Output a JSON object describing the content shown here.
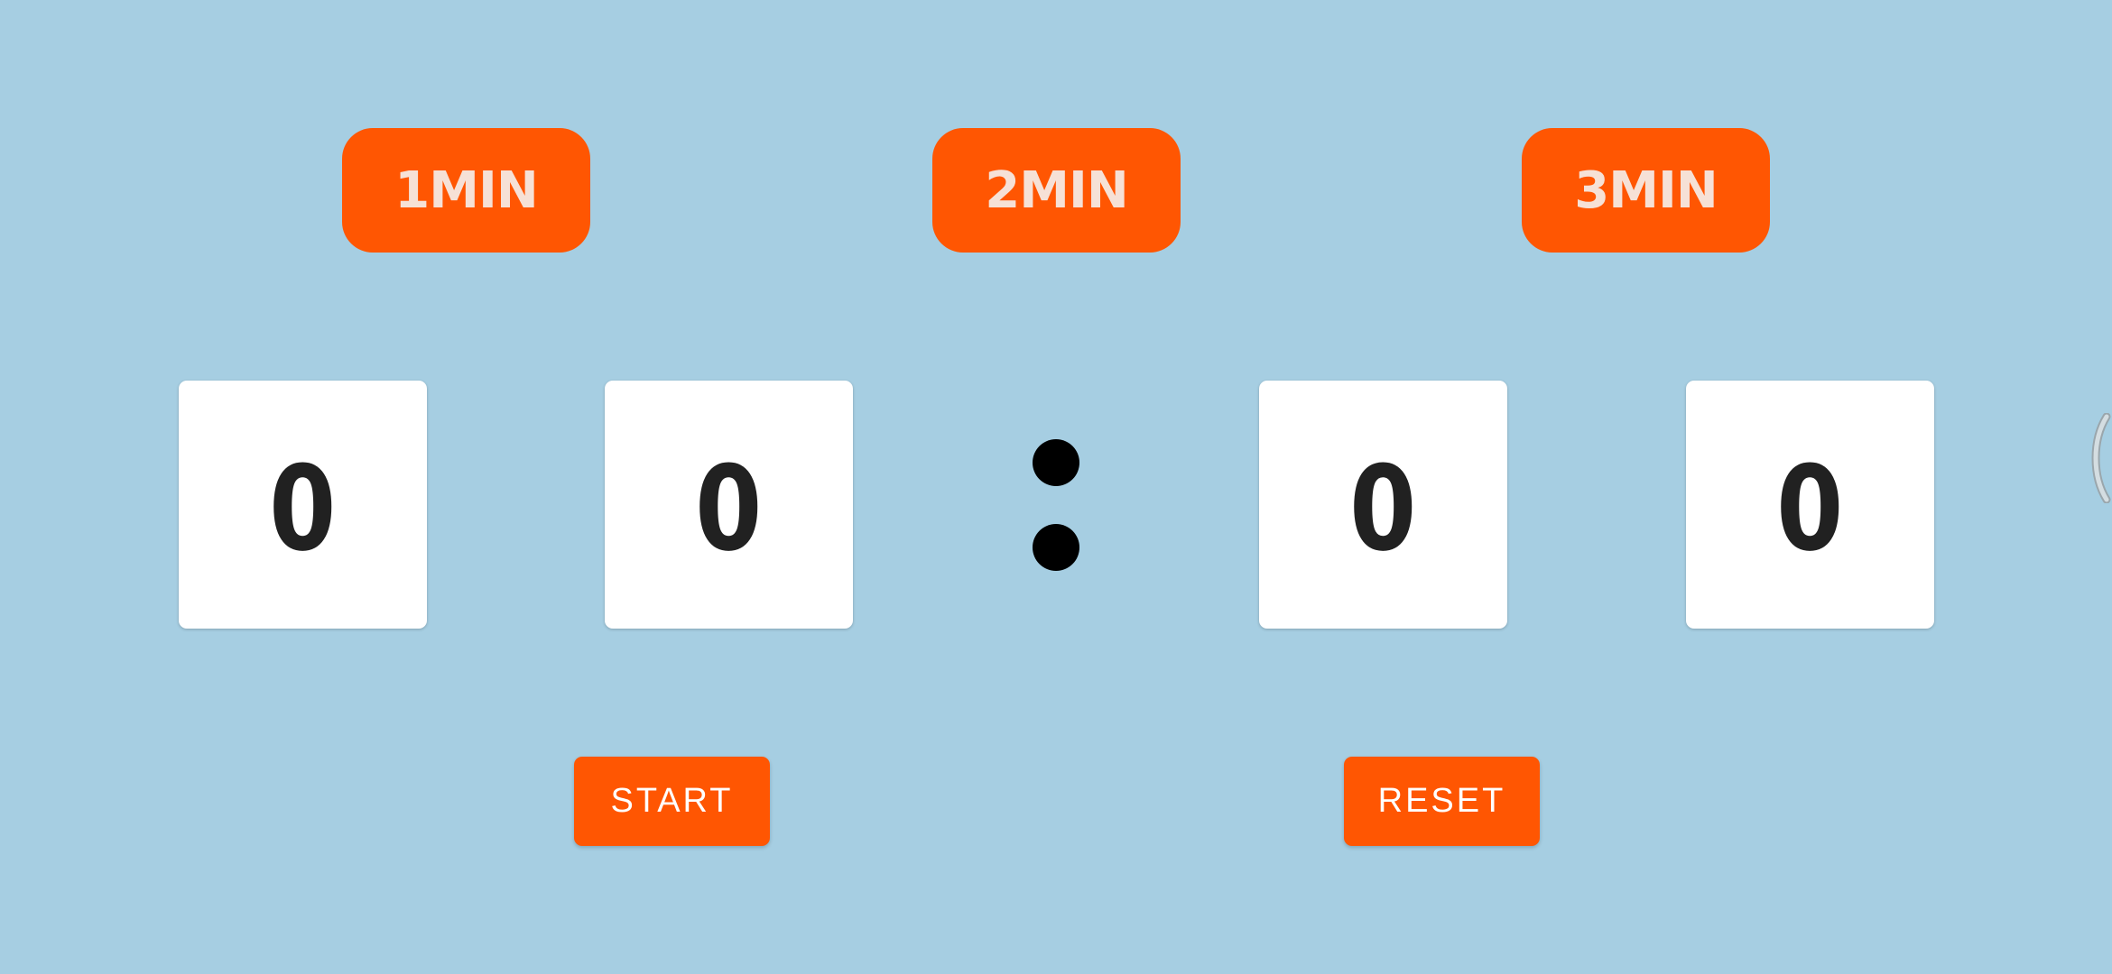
{
  "presets": {
    "one_min": "1MIN",
    "two_min": "2MIN",
    "three_min": "3MIN"
  },
  "timer": {
    "digits": [
      "0",
      "0",
      "0",
      "0"
    ]
  },
  "controls": {
    "start_label": "START",
    "reset_label": "RESET"
  },
  "colors": {
    "background": "#A6CEE2",
    "accent": "#FF5602",
    "card": "#FFFFFF",
    "digit_text": "#212121"
  }
}
